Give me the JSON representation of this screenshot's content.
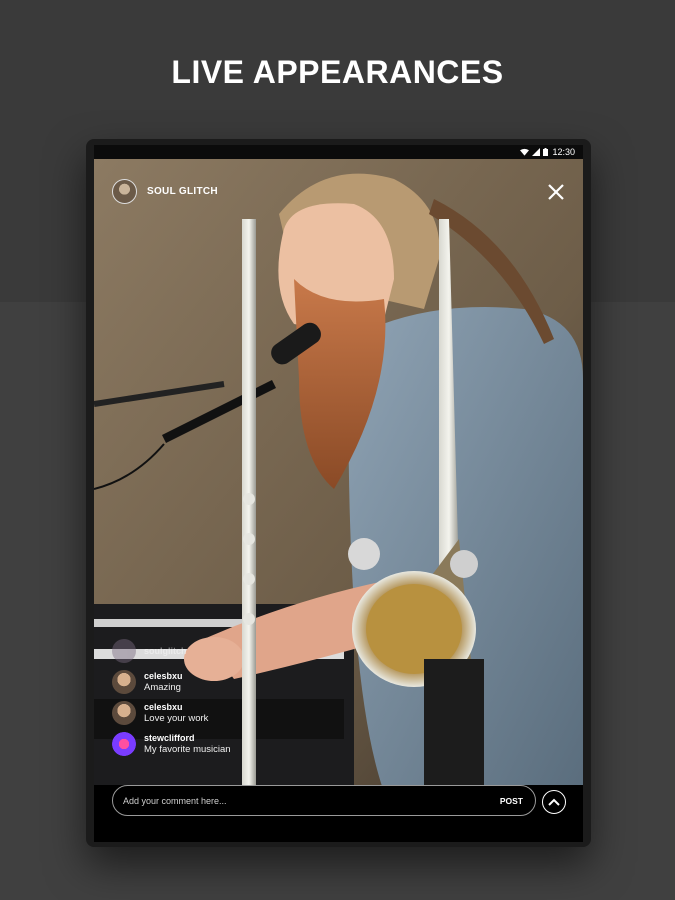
{
  "headline": "LIVE APPEARANCES",
  "status_bar": {
    "time": "12:30",
    "icons": [
      "wifi-icon",
      "signal-icon",
      "battery-icon"
    ]
  },
  "stream": {
    "host_name": "SOUL GLITCH",
    "close_icon": "close-icon"
  },
  "comments": [
    {
      "user": "soulglitch",
      "message": "",
      "faded": true
    },
    {
      "user": "celesbxu",
      "message": "Amazing"
    },
    {
      "user": "celesbxu",
      "message": "Love your work"
    },
    {
      "user": "stewclifford",
      "message": "My favorite musician"
    }
  ],
  "composer": {
    "placeholder": "Add your comment here...",
    "post_label": "POST",
    "scroll_icon": "chevron-up-icon"
  },
  "colors": {
    "background_top": "#3a3a3a",
    "background_bottom": "#404040",
    "device": "#1b1b1b",
    "text": "#ffffff"
  }
}
